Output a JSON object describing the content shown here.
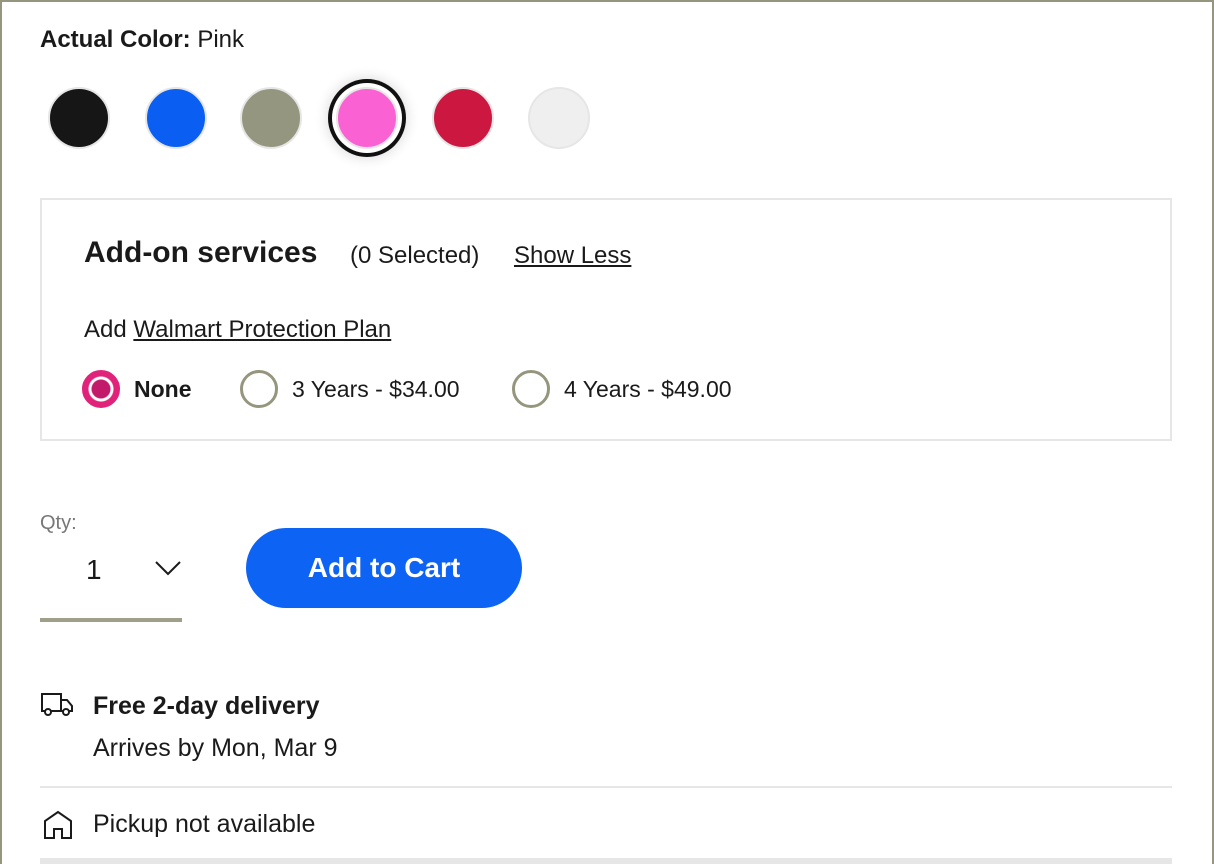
{
  "color": {
    "label": "Actual Color:",
    "value": "Pink",
    "swatches": [
      {
        "name": "black",
        "hex": "#161616"
      },
      {
        "name": "blue",
        "hex": "#0a5ff2"
      },
      {
        "name": "sage",
        "hex": "#95967f"
      },
      {
        "name": "pink",
        "hex": "#fa62d3",
        "selected": true
      },
      {
        "name": "red",
        "hex": "#cc1841"
      },
      {
        "name": "white",
        "hex": "#efefef"
      }
    ]
  },
  "addon": {
    "title": "Add-on services",
    "count": "(0 Selected)",
    "toggle": "Show Less",
    "plan_prefix": "Add",
    "plan_link": "Walmart Protection Plan",
    "options": [
      {
        "label": "None",
        "selected": true
      },
      {
        "label": "3 Years - $34.00",
        "selected": false
      },
      {
        "label": "4 Years - $49.00",
        "selected": false
      }
    ]
  },
  "qty": {
    "label": "Qty:",
    "value": "1"
  },
  "cart_button": "Add to Cart",
  "delivery": {
    "title": "Free 2-day delivery",
    "date": "Arrives by Mon, Mar 9"
  },
  "pickup": "Pickup not available"
}
